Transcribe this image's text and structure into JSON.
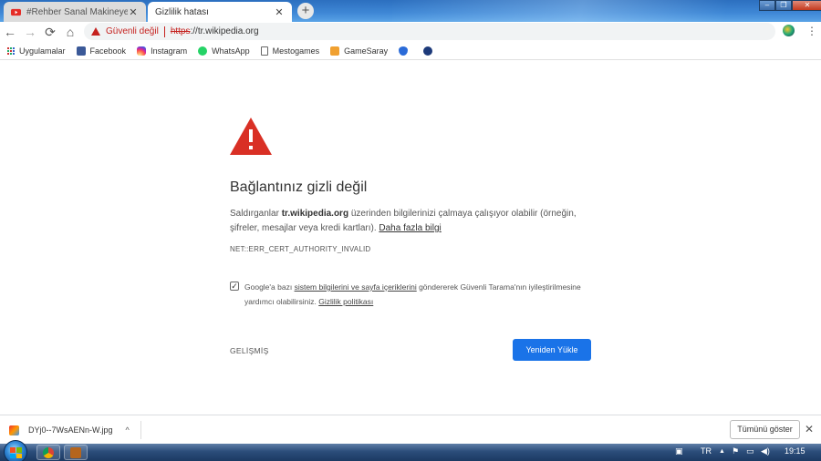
{
  "tabs": [
    {
      "title": "#Rehber Sanal Makineye Windows",
      "close": "✕",
      "icon": "youtube-icon"
    },
    {
      "title": "Gizlilik hatası",
      "close": "✕",
      "icon": "none"
    }
  ],
  "new_tab": "+",
  "window_controls": {
    "minimize": "–",
    "maximize": "❐",
    "close": "✕"
  },
  "toolbar": {
    "back": "←",
    "forward": "→",
    "reload": "⟳",
    "home": "⌂",
    "not_secure": "Güvenli değil",
    "url_scheme": "https",
    "url_rest": "://tr.wikipedia.org",
    "star": "☆",
    "menu": "⋮"
  },
  "bookmarks": [
    {
      "label": "Uygulamalar",
      "icon": "apps-icon"
    },
    {
      "label": "Facebook",
      "icon": "facebook-icon",
      "color": "#3b5998"
    },
    {
      "label": "Instagram",
      "icon": "instagram-icon",
      "color": "#c13584"
    },
    {
      "label": "WhatsApp",
      "icon": "whatsapp-icon",
      "color": "#25d366"
    },
    {
      "label": "Mestogames",
      "icon": "page-icon",
      "color": "#ffffff"
    },
    {
      "label": "GameSaray",
      "icon": "gamesaray-icon",
      "color": "#f0a030"
    }
  ],
  "error": {
    "title": "Bağlantınız gizli değil",
    "desc_prefix": "Saldırganlar ",
    "desc_domain": "tr.wikipedia.org",
    "desc_suffix": " üzerinden bilgilerinizi çalmaya çalışıyor olabilir (örneğin, şifreler, mesajlar veya kredi kartları). ",
    "learn_more": "Daha fazla bilgi",
    "code": "NET::ERR_CERT_AUTHORITY_INVALID",
    "optin_prefix": "Google'a bazı ",
    "optin_link": "sistem bilgilerini ve sayfa içeriklerini",
    "optin_middle": " göndererek Güvenli Tarama'nın iyileştirilmesine yardımcı olabilirsiniz. ",
    "privacy_link": "Gizlilik politikası",
    "checkbox_checked": "✓",
    "advanced": "GELİŞMİŞ",
    "reload": "Yeniden Yükle"
  },
  "download_bar": {
    "filename": "DYj0--7WsAENn-W.jpg",
    "chevron": "^",
    "show_all": "Tümünü göster",
    "close": "✕"
  },
  "taskbar": {
    "lang": "TR",
    "time": "19:15"
  },
  "colors": {
    "danger": "#c5221f",
    "primary": "#1a73e8",
    "warning_triangle": "#d93025"
  }
}
